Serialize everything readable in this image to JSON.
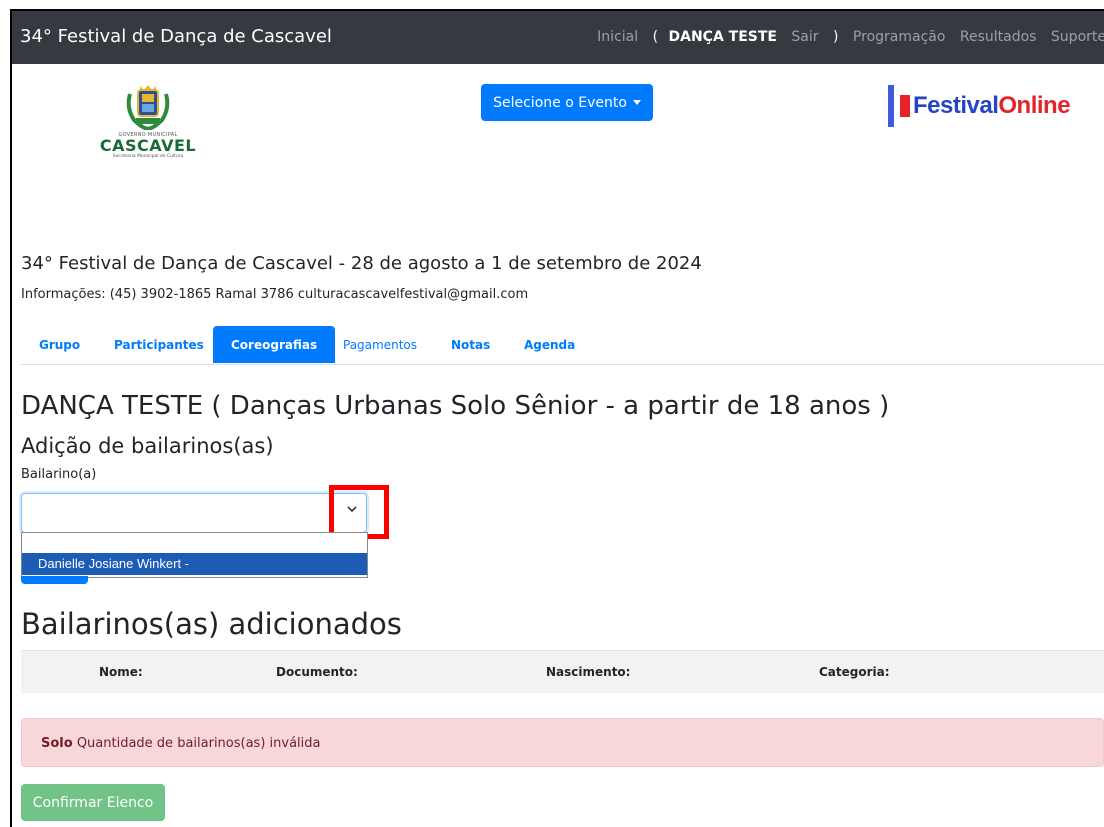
{
  "navbar": {
    "brand": "34° Festival de Dança de Cascavel",
    "links": {
      "inicial": "Inicial",
      "open_paren": "(",
      "user": "DANÇA TESTE",
      "sair": "Sair",
      "close_paren": ")",
      "programacao": "Programação",
      "resultados": "Resultados",
      "suporte": "Suporte"
    }
  },
  "logos": {
    "cascavel_gov": "GOVERNO MUNICIPAL",
    "cascavel_name": "CASCAVEL",
    "cascavel_sec": "Secretaria Municipal de Cultura",
    "festival_online_a": "Festival",
    "festival_online_b": "Online"
  },
  "event_select": {
    "label": "Selecione o Evento"
  },
  "header": {
    "title": "34° Festival de Dança de Cascavel - 28 de agosto a 1 de setembro de 2024",
    "info": "Informações: (45) 3902-1865 Ramal 3786 culturacascavelfestival@gmail.com"
  },
  "tabs": [
    {
      "label": "Grupo"
    },
    {
      "label": "Participantes"
    },
    {
      "label": "Coreografias"
    },
    {
      "label": "Pagamentos"
    },
    {
      "label": "Notas"
    },
    {
      "label": "Agenda"
    }
  ],
  "main": {
    "dance_title": "DANÇA TESTE ( Danças Urbanas Solo Sênior - a partir de 18 anos )",
    "add_title": "Adição de bailarinos(as)",
    "field_label": "Bailarino(a)",
    "select_value": "",
    "dropdown_options": [
      "",
      "Danielle Josiane Winkert -"
    ],
    "added_title": "Bailarinos(as) adicionados",
    "table_headers": [
      "Nome:",
      "Documento:",
      "Nascimento:",
      "Categoria:"
    ]
  },
  "alert": {
    "strong": "Solo",
    "message": " Quantidade de bailarinos(as) inválida"
  },
  "confirm_button": "Confirmar Elenco",
  "colors": {
    "navbar": "#343a40",
    "primary": "#007bff",
    "alert_bg": "#f8d7da",
    "success_light": "#72c387",
    "highlight": "#ff0000"
  }
}
